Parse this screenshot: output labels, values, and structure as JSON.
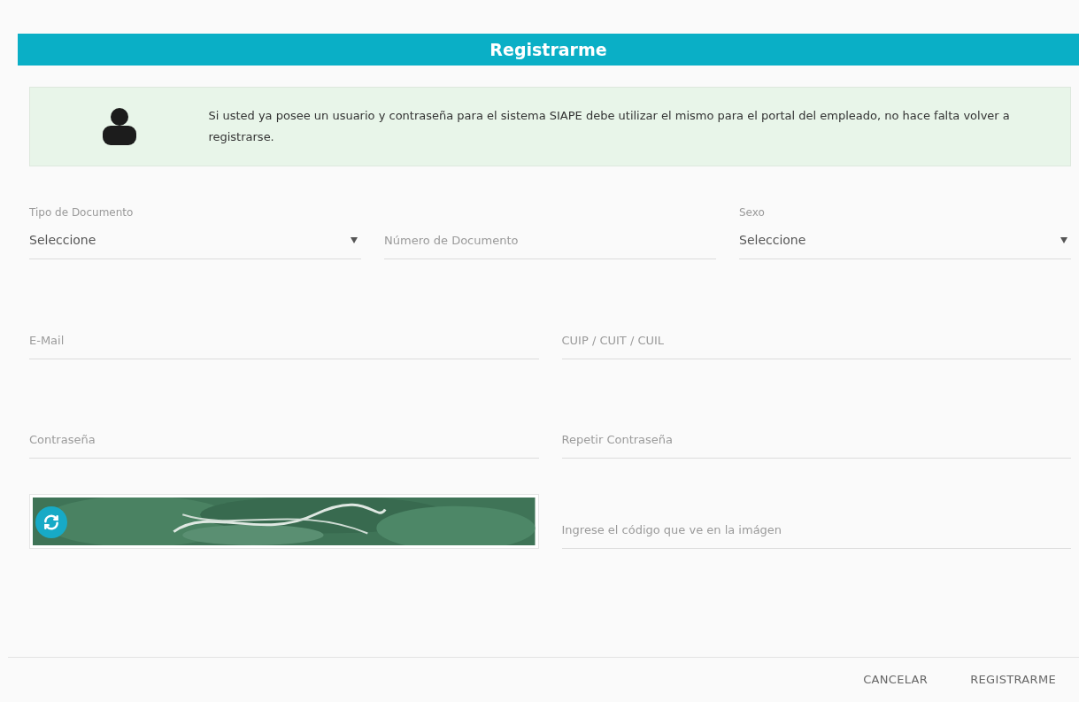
{
  "header": {
    "title": "Registrarme"
  },
  "notice": {
    "text": "Si usted ya posee un usuario y contraseña para el sistema SIAPE debe utilizar el mismo para el portal del empleado, no hace falta volver a registrarse."
  },
  "form_rows": [
    [
      {
        "kind": "select",
        "label": "Tipo de Documento",
        "value": "Seleccione"
      },
      {
        "kind": "input",
        "placeholder": "Número de Documento"
      },
      {
        "kind": "select",
        "label": "Sexo",
        "value": "Seleccione"
      }
    ],
    [
      {
        "kind": "input",
        "placeholder": "E-Mail"
      },
      {
        "kind": "input",
        "placeholder": "CUIP / CUIT / CUIL"
      }
    ],
    [
      {
        "kind": "input",
        "placeholder": "Contraseña"
      },
      {
        "kind": "input",
        "placeholder": "Repetir Contraseña"
      }
    ],
    [
      {
        "kind": "captcha"
      },
      {
        "kind": "input",
        "placeholder": "Ingrese el código que ve en la imágen"
      }
    ]
  ],
  "buttons": [
    "CANCELAR",
    "REGISTRARME"
  ]
}
